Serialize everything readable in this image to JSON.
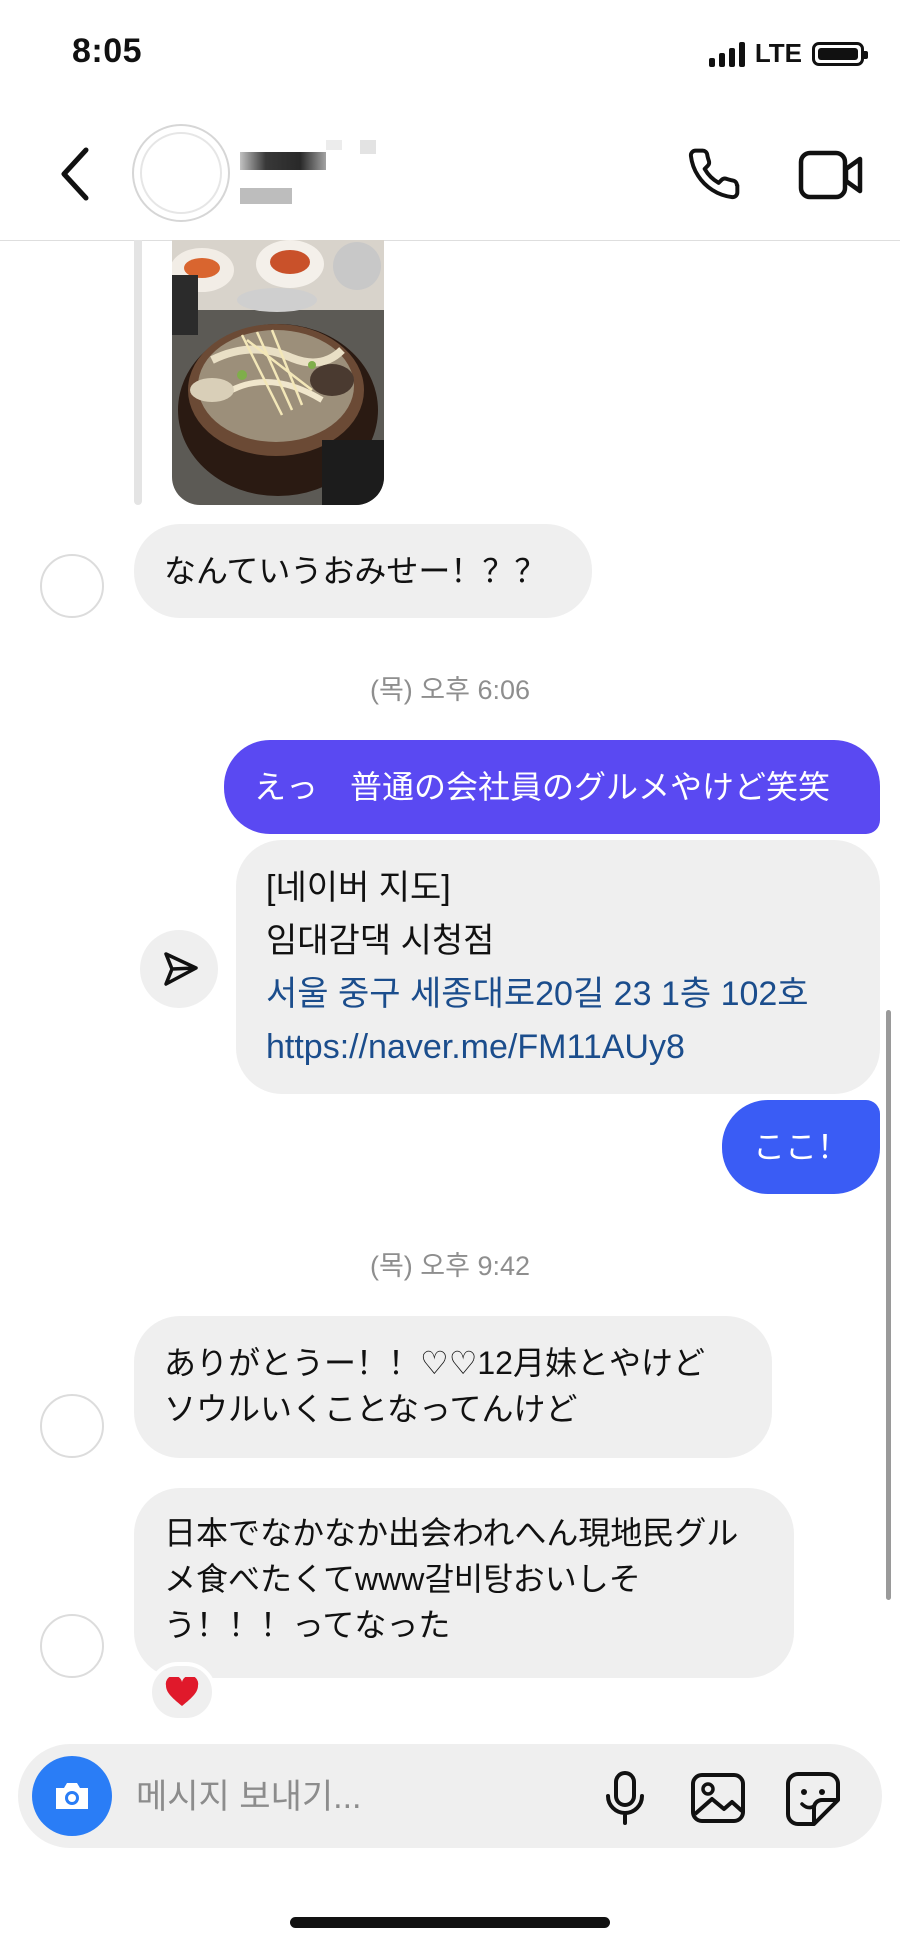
{
  "status_bar": {
    "time": "8:05",
    "network": "LTE"
  },
  "header": {
    "back_icon": "chevron-left-icon",
    "call_icon": "phone-icon",
    "video_icon": "video-camera-icon"
  },
  "messages": {
    "photo_description": "food-photo",
    "incoming_1": "なんていうおみせー！？？",
    "timestamp_1": "(목) 오후 6:06",
    "outgoing_1": "えっ　普通の会社員のグルメやけど笑笑",
    "link_card": {
      "line1": "[네이버 지도]",
      "line2": "임대감댁 시청점",
      "address": "서울 중구 세종대로20길 23 1층 102호",
      "url": "https://naver.me/FM11AUy8"
    },
    "outgoing_2": "ここ！",
    "timestamp_2": "(목) 오후 9:42",
    "incoming_2_line1": "ありがとうー！！♡♡12月妹とやけど",
    "incoming_2_line2": "ソウルいくことなってんけど",
    "incoming_3_line1": "日本でなかなか出会われへん現地民グル",
    "incoming_3_line2": "メ食べたくてwww갈비탕おいしそ",
    "incoming_3_line3": "う！！！ってなった",
    "reaction": "❤️"
  },
  "composer": {
    "placeholder": "메시지 보내기...",
    "value": ""
  },
  "colors": {
    "outgoing_purple": "#5a49f2",
    "outgoing_blue": "#3a5cf5",
    "camera_blue": "#2a7df6",
    "link_blue": "#1b4d8c"
  }
}
